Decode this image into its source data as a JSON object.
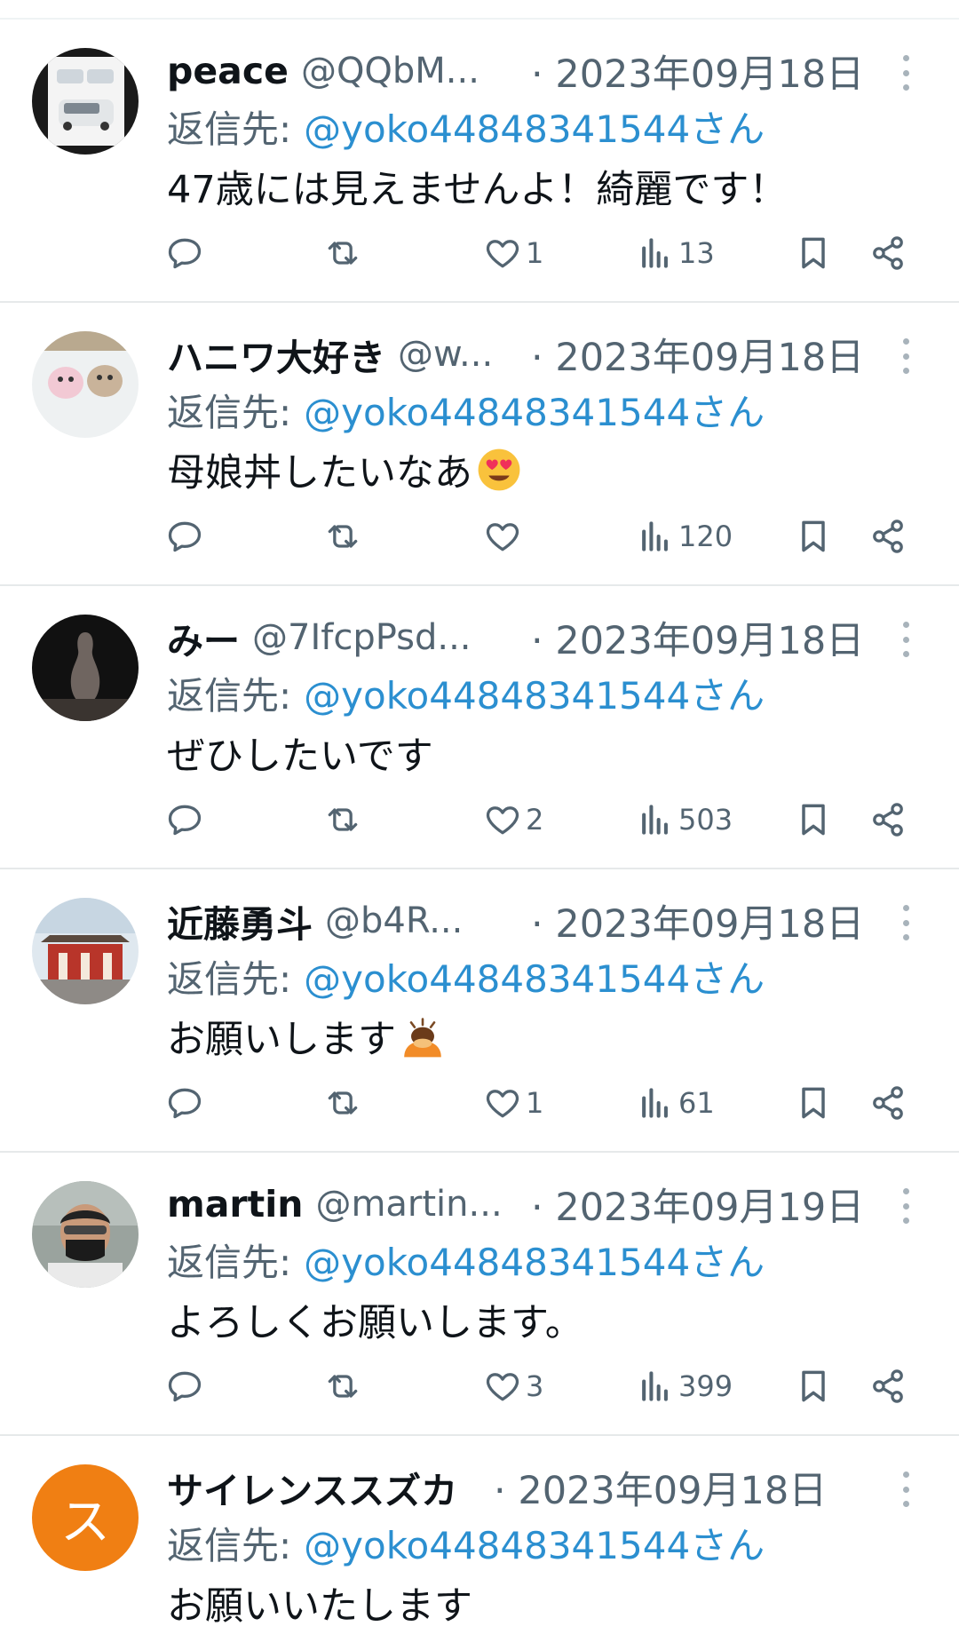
{
  "reply_prefix": "返信先:",
  "tweets": [
    {
      "name": "peace",
      "handle": "@QQbM...",
      "date": "· 2023年09月18日",
      "mention": "@yoko44848341544さん",
      "text": "47歳には見えませんよ！綺麗です！",
      "likes": "1",
      "views": "13",
      "avatar": "photo-car"
    },
    {
      "name": "ハニワ大好き",
      "handle": "@w...",
      "date": "· 2023年09月18日",
      "mention": "@yoko44848341544さん",
      "text": "母娘丼したいなあ",
      "text_emoji": "heart-eyes-emoji",
      "likes": "",
      "views": "120",
      "avatar": "photo-figurines"
    },
    {
      "name": "みー",
      "handle": "@7IfcpPsd...",
      "date": "· 2023年09月18日",
      "mention": "@yoko44848341544さん",
      "text": "ぜひしたいです",
      "likes": "2",
      "views": "503",
      "avatar": "photo-dark"
    },
    {
      "name": "近藤勇斗",
      "handle": "@b4R...",
      "date": "· 2023年09月18日",
      "mention": "@yoko44848341544さん",
      "text": "お願いします",
      "text_emoji": "bowing-person-emoji",
      "likes": "1",
      "views": "61",
      "avatar": "photo-shrine"
    },
    {
      "name": "martin",
      "handle": "@martin...",
      "date": "· 2023年09月19日",
      "mention": "@yoko44848341544さん",
      "text": "よろしくお願いします。",
      "likes": "3",
      "views": "399",
      "avatar": "photo-man"
    },
    {
      "name": "サイレンススズカ",
      "handle": "",
      "date": "· 2023年09月18日",
      "mention": "@yoko44848341544さん",
      "text": "お願いいたします",
      "avatar_letter": "ス",
      "avatar_color": "#f07f13"
    }
  ],
  "colors": {
    "link": "#2b8fd0",
    "muted": "#536471",
    "divider": "#e6e9ea"
  },
  "icons": [
    "reply-icon",
    "retweet-icon",
    "like-icon",
    "views-icon",
    "bookmark-icon",
    "share-icon",
    "more-icon"
  ]
}
